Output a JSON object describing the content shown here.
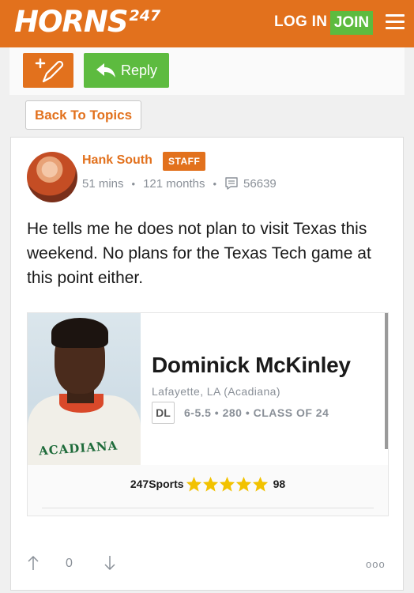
{
  "header": {
    "logo_text": "HORNS",
    "logo_superscript": "247",
    "login_label": "LOG IN",
    "join_label": "JOIN"
  },
  "toolbar": {
    "reply_label": "Reply"
  },
  "nav": {
    "back_label": "Back To Topics"
  },
  "post": {
    "author": "Hank South",
    "badge": "STAFF",
    "time_ago": "51 mins",
    "member_since": "121 months",
    "post_count": "56639",
    "body": "He tells me he does not plan to visit Texas this weekend. No plans for the Texas Tech game at this point either.",
    "votes": "0",
    "more_label": "ooo"
  },
  "player_card": {
    "jersey_text": "ACADIANA",
    "name": "Dominick McKinley",
    "location": "Lafayette, LA (Acadiana)",
    "position": "DL",
    "stats": "6-5.5 • 280 • CLASS OF 24",
    "rating_source": "247Sports",
    "stars": 5,
    "rating_score": "98"
  },
  "colors": {
    "brand_orange": "#e2711d",
    "join_green": "#5dbb3f",
    "star_yellow": "#f2c200"
  },
  "icons": [
    "edit-pencil-icon",
    "reply-arrow-icon",
    "menu-icon",
    "comment-icon",
    "star-icon",
    "upvote-arrow-icon",
    "downvote-arrow-icon"
  ]
}
